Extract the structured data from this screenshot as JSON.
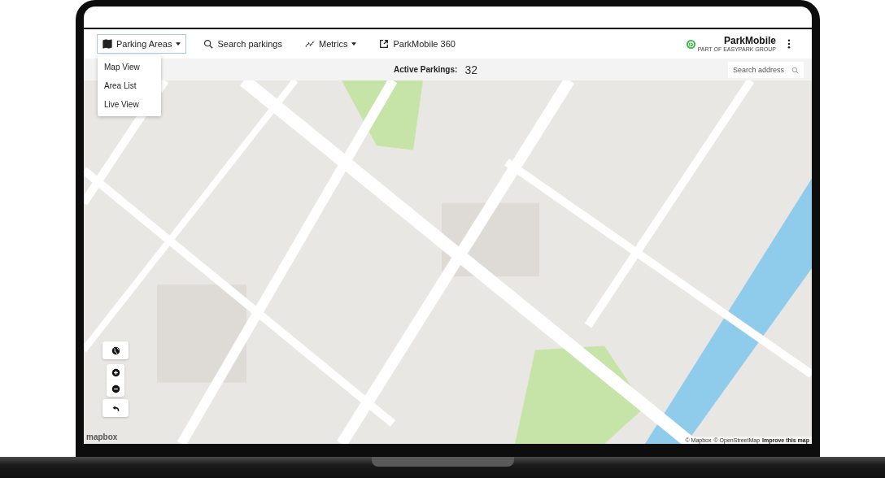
{
  "nav": [
    {
      "label": "Parking Areas",
      "caret": true,
      "selected": true
    },
    {
      "label": "Search parkings",
      "caret": false,
      "selected": false
    },
    {
      "label": "Metrics",
      "caret": true,
      "selected": false
    },
    {
      "label": "ParkMobile 360",
      "caret": false,
      "selected": false
    }
  ],
  "brand": {
    "name": "ParkMobile",
    "tagline": "PART OF EASYPARK GROUP"
  },
  "dropdown": {
    "items": [
      {
        "label": "Map View"
      },
      {
        "label": "Area List"
      },
      {
        "label": "Live View"
      }
    ]
  },
  "stats": {
    "label": "Active Parkings:",
    "value": "32"
  },
  "address_search": {
    "placeholder": "Search address"
  },
  "map": {
    "kind": "picture",
    "controls": [
      {
        "kind": "globe"
      },
      {
        "kind": "zoom_in"
      },
      {
        "kind": "zoom_out"
      },
      {
        "kind": "reset"
      }
    ],
    "logo": "mapbox",
    "attribution": [
      "© Mapbox",
      "© OpenStreetMap"
    ],
    "improve_link": "Improve this map"
  }
}
